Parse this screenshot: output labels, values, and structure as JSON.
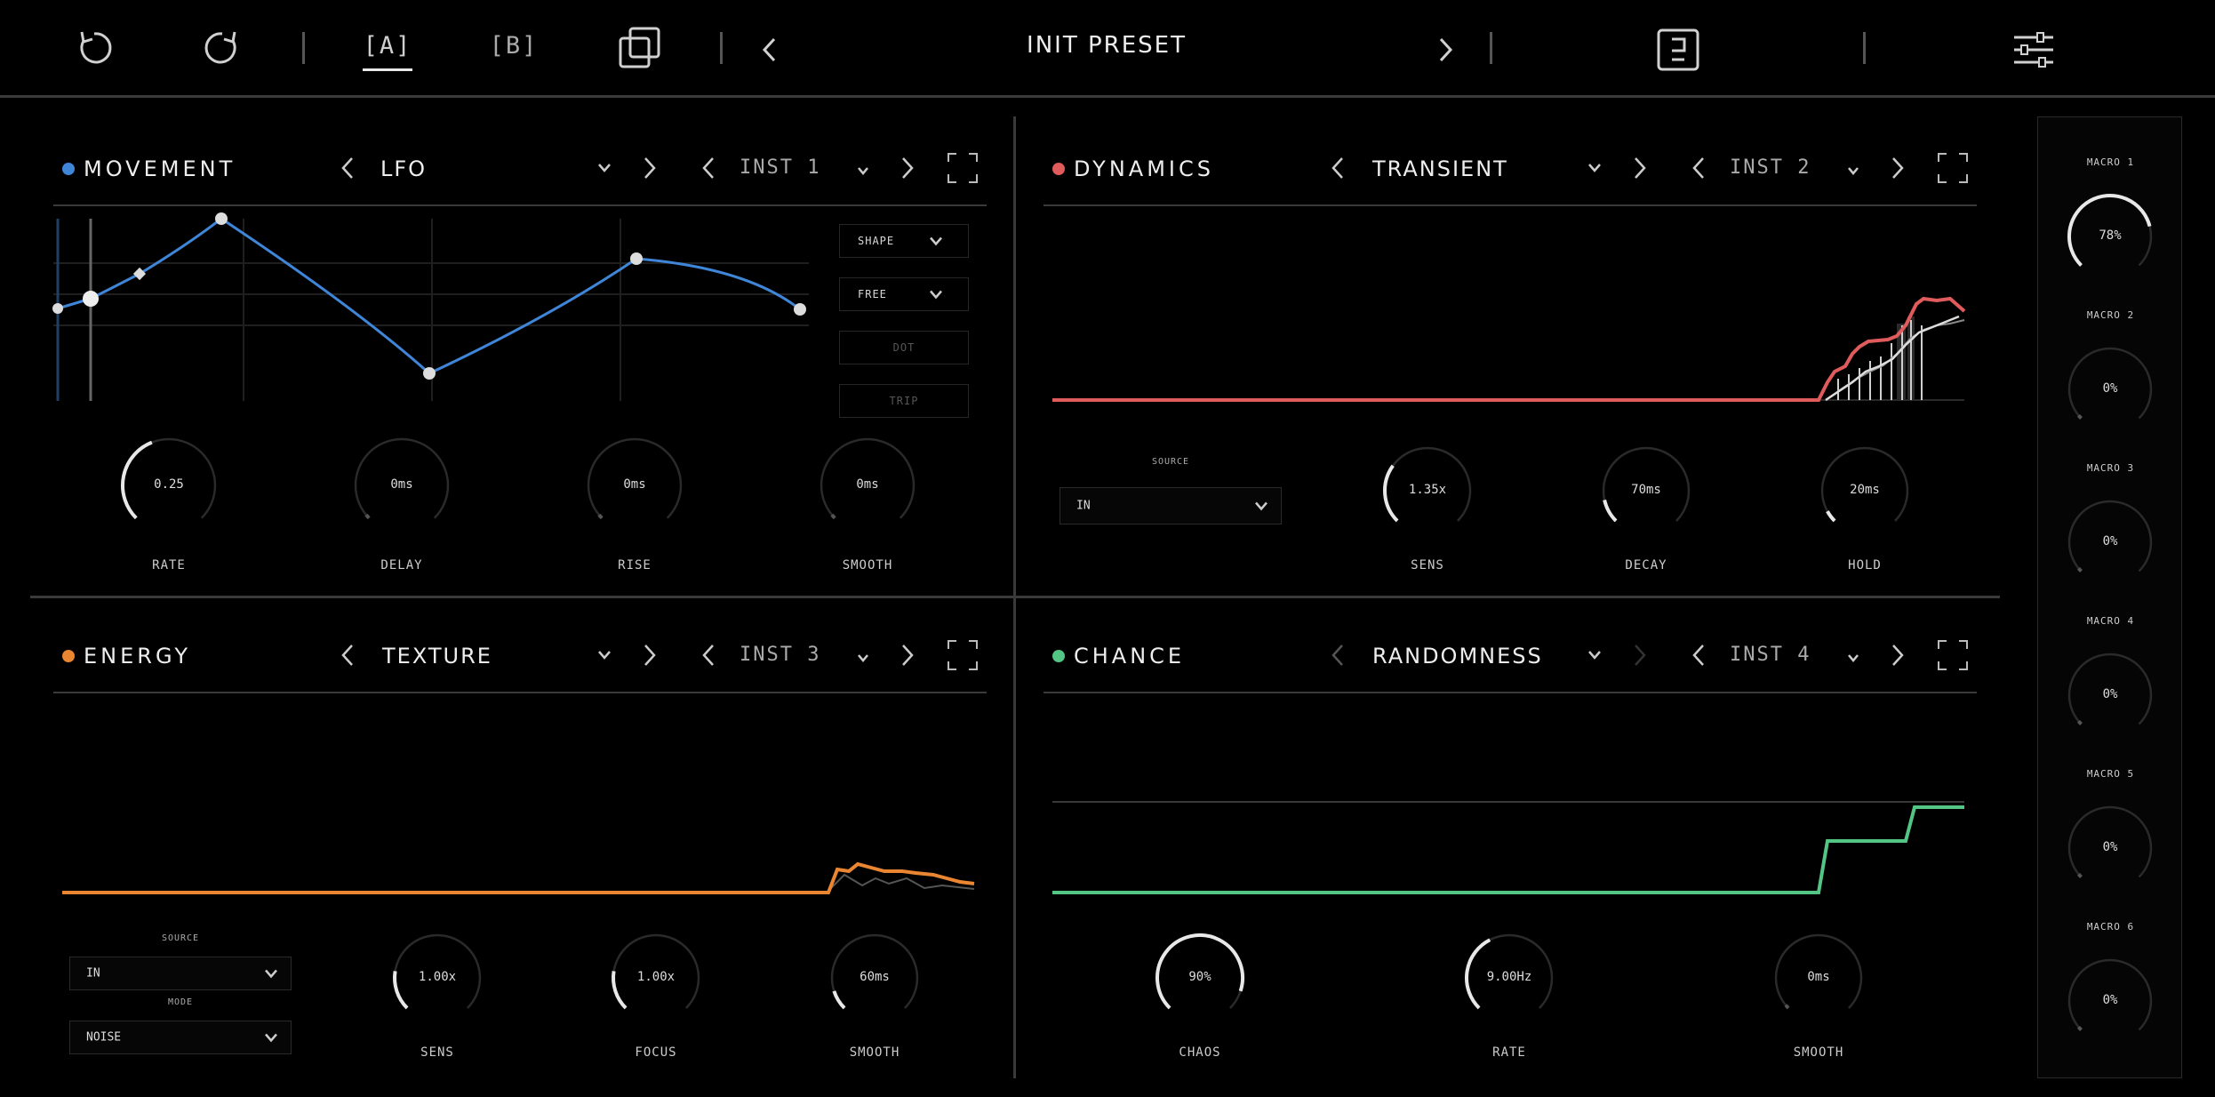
{
  "topbar": {
    "a_label": "[A]",
    "b_label": "[B]",
    "preset_name": "INIT PRESET"
  },
  "panels": {
    "movement": {
      "title": "MOVEMENT",
      "color": "#3f86d8",
      "module": "LFO",
      "inst": "INST 1",
      "side_buttons": {
        "shape": "SHAPE",
        "free": "FREE",
        "dot": "DOT",
        "trip": "TRIP"
      },
      "knobs": [
        {
          "label": "RATE",
          "value": "0.25",
          "level": 0.42
        },
        {
          "label": "DELAY",
          "value": "0ms",
          "level": 0.0
        },
        {
          "label": "RISE",
          "value": "0ms",
          "level": 0.0
        },
        {
          "label": "SMOOTH",
          "value": "0ms",
          "level": 0.0
        }
      ]
    },
    "dynamics": {
      "title": "DYNAMICS",
      "color": "#e05b5b",
      "module": "TRANSIENT",
      "inst": "INST 2",
      "source_label": "SOURCE",
      "source_value": "IN",
      "knobs": [
        {
          "label": "SENS",
          "value": "1.35x",
          "level": 0.3
        },
        {
          "label": "DECAY",
          "value": "70ms",
          "level": 0.12
        },
        {
          "label": "HOLD",
          "value": "20ms",
          "level": 0.06
        }
      ]
    },
    "energy": {
      "title": "ENERGY",
      "color": "#ea8632",
      "module": "TEXTURE",
      "inst": "INST 3",
      "source_label": "SOURCE",
      "source_value": "IN",
      "mode_label": "MODE",
      "mode_value": "NOISE",
      "knobs": [
        {
          "label": "SENS",
          "value": "1.00x",
          "level": 0.2
        },
        {
          "label": "FOCUS",
          "value": "1.00x",
          "level": 0.2
        },
        {
          "label": "SMOOTH",
          "value": "60ms",
          "level": 0.1
        }
      ]
    },
    "chance": {
      "title": "CHANCE",
      "color": "#53c584",
      "module": "RANDOMNESS",
      "inst": "INST 4",
      "knobs": [
        {
          "label": "CHAOS",
          "value": "90%",
          "level": 0.9
        },
        {
          "label": "RATE",
          "value": "9.00Hz",
          "level": 0.4
        },
        {
          "label": "SMOOTH",
          "value": "0ms",
          "level": 0.0
        }
      ]
    }
  },
  "macros": [
    {
      "label": "MACRO 1",
      "value": "78%",
      "level": 0.78
    },
    {
      "label": "MACRO 2",
      "value": "0%",
      "level": 0.0
    },
    {
      "label": "MACRO 3",
      "value": "0%",
      "level": 0.0
    },
    {
      "label": "MACRO 4",
      "value": "0%",
      "level": 0.0
    },
    {
      "label": "MACRO 5",
      "value": "0%",
      "level": 0.0
    },
    {
      "label": "MACRO 6",
      "value": "0%",
      "level": 0.0
    }
  ],
  "icons": [
    "undo-icon",
    "redo-icon",
    "copy-icon",
    "chevron-left-icon",
    "chevron-right-icon",
    "save-icon",
    "settings-sliders-icon",
    "chevron-down-icon",
    "expand-icon"
  ]
}
